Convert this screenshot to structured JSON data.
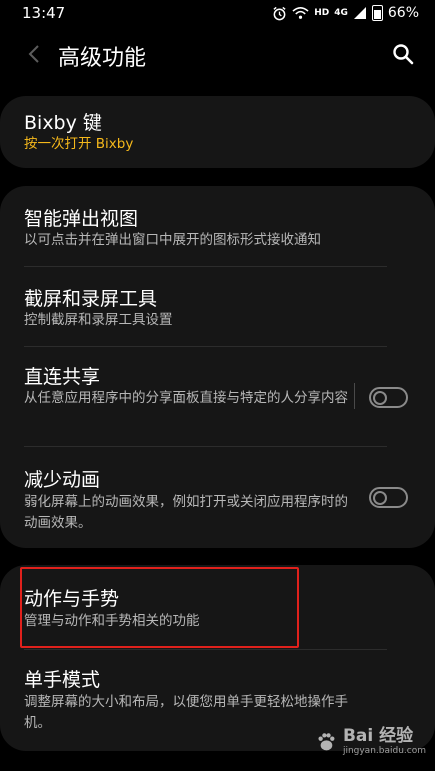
{
  "status_bar": {
    "time": "13:47",
    "battery": "66%",
    "hd_label": "HD",
    "network_label": "4G",
    "icons": [
      "alarm-icon",
      "wifi-icon",
      "signal-icon",
      "battery-icon"
    ]
  },
  "header": {
    "title": "高级功能",
    "back_icon": "chevron-left-icon",
    "search_icon": "search-icon"
  },
  "groups": [
    {
      "items": [
        {
          "title": "Bixby 键",
          "subtitle": "按一次打开 Bixby",
          "subtitle_color": "#f5b81b"
        }
      ]
    },
    {
      "items": [
        {
          "title": "智能弹出视图",
          "subtitle": "以可点击并在弹出窗口中展开的图标形式接收通知"
        },
        {
          "title": "截屏和录屏工具",
          "subtitle": "控制截屏和录屏工具设置"
        },
        {
          "title": "直连共享",
          "subtitle": "从任意应用程序中的分享面板直接与特定的人分享内容",
          "toggle": "off"
        },
        {
          "title": "减少动画",
          "subtitle": "弱化屏幕上的动画效果，例如打开或关闭应用程序时的动画效果。",
          "toggle": "off"
        }
      ]
    },
    {
      "items": [
        {
          "title": "动作与手势",
          "subtitle": "管理与动作和手势相关的功能",
          "highlighted": true
        },
        {
          "title": "单手模式",
          "subtitle": "调整屏幕的大小和布局，以便您用单手更轻松地操作手机。"
        }
      ]
    }
  ],
  "watermark": {
    "main": "Bai 经验",
    "sub": "jingyan.baidu.com"
  },
  "colors": {
    "background": "#000000",
    "card": "#161616",
    "accent": "#f5b81b",
    "highlight_border": "#e0211c",
    "secondary_text": "#b7b7b7"
  }
}
